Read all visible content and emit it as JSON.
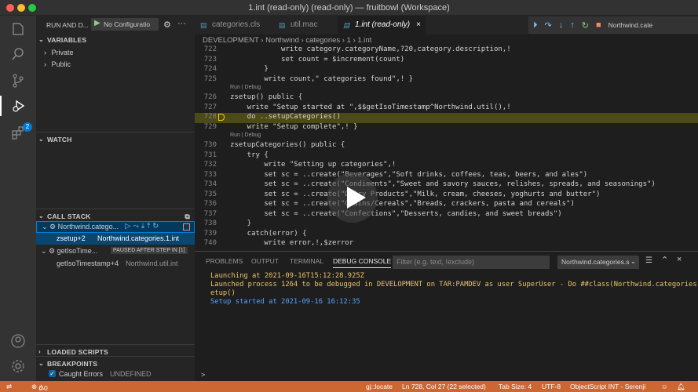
{
  "window": {
    "title": "1.int (read-only) (read-only) — fruitbowl (Workspace)"
  },
  "sidebar": {
    "run_label": "RUN AND D...",
    "config_label": "No Configuratio",
    "variables_header": "VARIABLES",
    "variables": [
      "Private",
      "Public"
    ],
    "watch_header": "WATCH",
    "callstack_header": "CALL STACK",
    "callstack": [
      {
        "name": "Northwind.catego..."
      },
      {
        "frame": "zsetup+2",
        "file": "Northwind.categories.1.int"
      },
      {
        "name": "getIsoTime...",
        "status": "PAUSED AFTER STEP IN [1]"
      },
      {
        "frame": "getIsoTimestamp+4",
        "file": "Northwind.util.int"
      }
    ],
    "loaded_scripts_header": "LOADED SCRIPTS",
    "breakpoints_header": "BREAKPOINTS",
    "breakpoint_label": "Caught Errors",
    "breakpoint_value": "UNDEFINED",
    "badge": "2"
  },
  "tabs": [
    {
      "label": "categories.cls"
    },
    {
      "label": "util.mac"
    },
    {
      "label": "1.int (read-only)"
    }
  ],
  "debug_target": "Northwind.cate",
  "breadcrumb": [
    "DEVELOPMENT",
    "Northwind",
    "categories",
    "1",
    "1.int"
  ],
  "code": [
    {
      "n": "722",
      "t": "            write category.categoryName,?20,category.description,!"
    },
    {
      "n": "723",
      "t": "            set count = $increment(count)"
    },
    {
      "n": "724",
      "t": "        }"
    },
    {
      "n": "725",
      "t": "        write count,\" categories found\",! }"
    },
    {
      "lens": "Run | Debug"
    },
    {
      "n": "726",
      "t": "zsetup() public {"
    },
    {
      "n": "727",
      "t": "    write \"Setup started at \",$$getIsoTimestamp^Northwind.util(),!"
    },
    {
      "n": "728",
      "t": "    do ..setupCategories()",
      "hl": true
    },
    {
      "n": "729",
      "t": "    write \"Setup complete\",! }"
    },
    {
      "lens": "Run | Debug"
    },
    {
      "n": "730",
      "t": "zsetupCategories() public {"
    },
    {
      "n": "731",
      "t": "    try {"
    },
    {
      "n": "732",
      "t": "        write \"Setting up categories\",!"
    },
    {
      "n": "733",
      "t": "        set sc = ..create(\"Beverages\",\"Soft drinks, coffees, teas, beers, and ales\")"
    },
    {
      "n": "734",
      "t": "        set sc = ..create(\"Condiments\",\"Sweet and savory sauces, relishes, spreads, and seasonings\")"
    },
    {
      "n": "735",
      "t": "        set sc = ..create(\"Dairy Products\",\"Milk, cream, cheeses, yoghurts and butter\")"
    },
    {
      "n": "736",
      "t": "        set sc = ..create(\"Grains/Cereals\",\"Breads, crackers, pasta and cereals\")"
    },
    {
      "n": "737",
      "t": "        set sc = ..create(\"Confections\",\"Desserts, candies, and sweet breads\")"
    },
    {
      "n": "738",
      "t": "    }"
    },
    {
      "n": "739",
      "t": "    catch(error) {"
    },
    {
      "n": "740",
      "t": "        write error,!,$zerror"
    }
  ],
  "panel": {
    "tabs": [
      "PROBLEMS",
      "OUTPUT",
      "TERMINAL",
      "DEBUG CONSOLE"
    ],
    "filter_placeholder": "Filter (e.g. text, !exclude)",
    "select_value": "Northwind.categories.s",
    "console": [
      {
        "t": "Launching at 2021-09-16T15:12:28.925Z",
        "c": "#e9c46a"
      },
      {
        "t": "Launched process 1264 to be debugged in DEVELOPMENT on TAR:PAMDEV as user SuperUser - Do ##class(Northwind.categories).s",
        "c": "#e9c46a"
      },
      {
        "t": "etup()",
        "c": "#e9c46a"
      },
      {
        "t": "Setup started at 2021-09-16 16:12:35",
        "c": "#4fa3ff"
      }
    ],
    "prompt": ">"
  },
  "status": {
    "errors": "0",
    "warnings": "0",
    "locate": "gj::locate",
    "position": "Ln 728, Col 27 (22 selected)",
    "tabsize": "Tab Size: 4",
    "encoding": "UTF-8",
    "language": "ObjectScript INT - Serenji"
  }
}
